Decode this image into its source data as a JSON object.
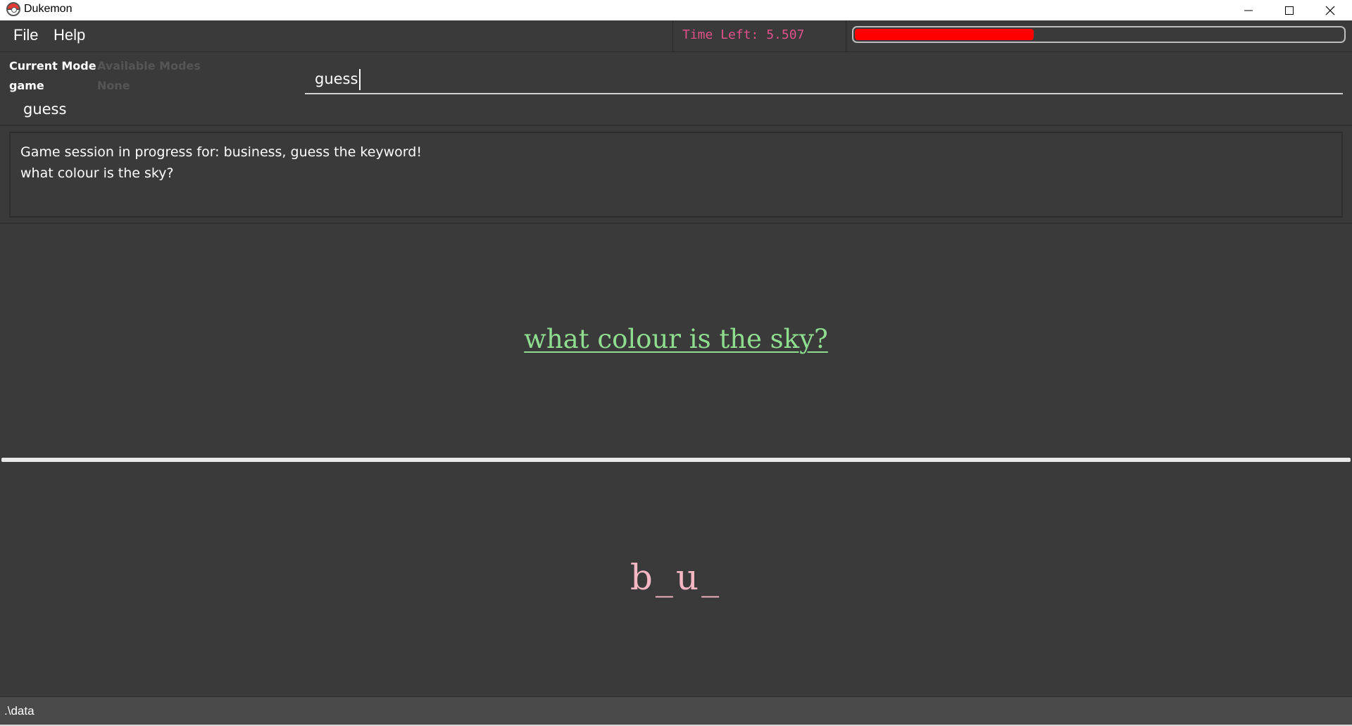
{
  "window": {
    "title": "Dukemon",
    "icon": "pokeball-icon"
  },
  "menu": {
    "file_label": "File",
    "help_label": "Help"
  },
  "timer": {
    "text": "Time Left: 5.507",
    "remaining_fraction": 0.37,
    "bar_color": "#ff0000",
    "text_color": "#e0508a"
  },
  "modes": {
    "current_heading": "Current Mode",
    "available_heading": "Available Modes",
    "current_value": "game",
    "available_value": "None"
  },
  "command": {
    "input_value": "guess",
    "last_command": "guess"
  },
  "result": {
    "line1": "Game session in progress for: business, guess the keyword!",
    "line2": "what colour is the sky?"
  },
  "game": {
    "question": "what colour is the sky?",
    "hint": "b_u_",
    "question_color": "#8fde8f",
    "hint_color": "#f5b7c4"
  },
  "status": {
    "path": ".\\data"
  }
}
